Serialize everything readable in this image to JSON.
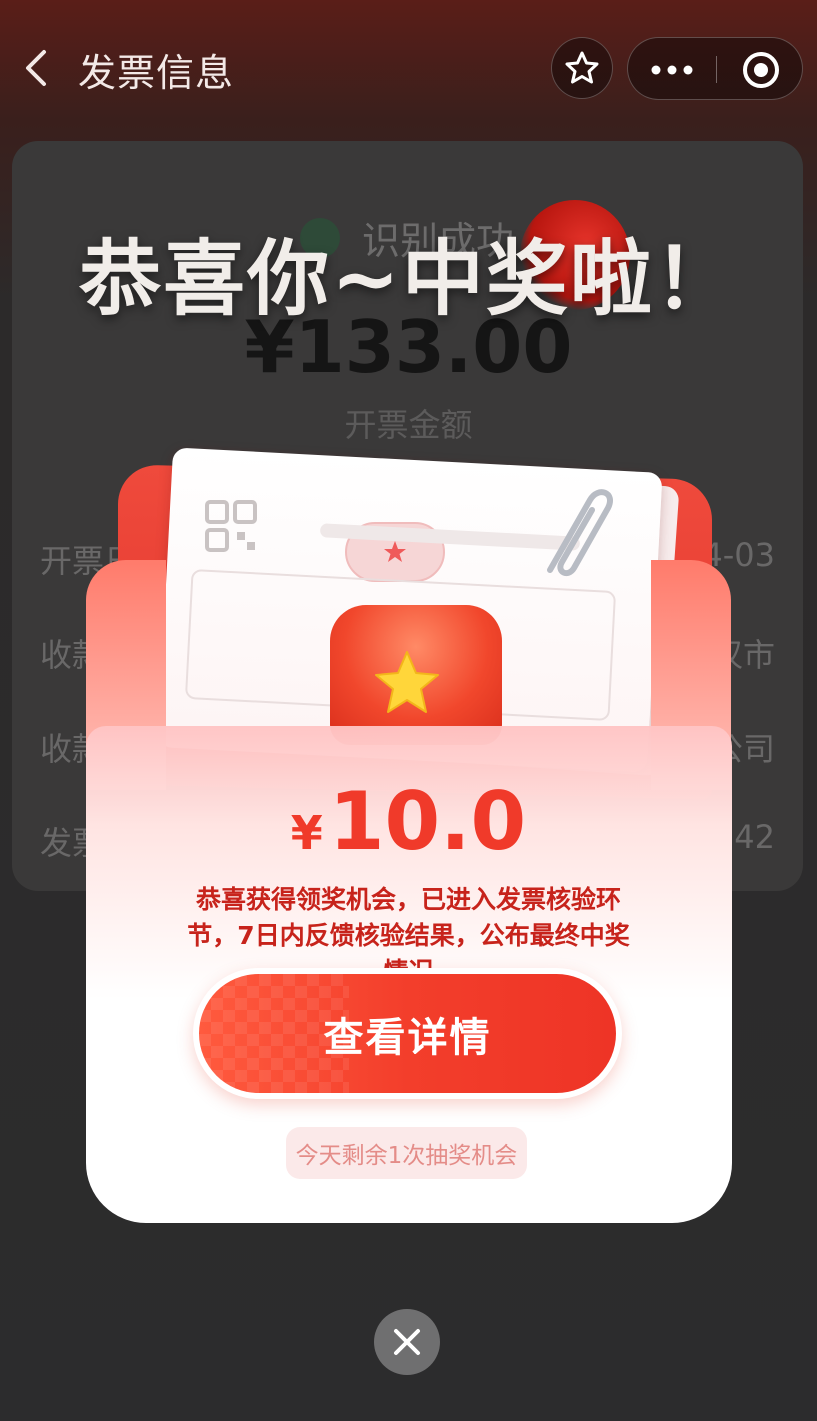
{
  "nav": {
    "title": "发票信息"
  },
  "background": {
    "status_text": "识别成功",
    "amount": "¥133.00",
    "amount_label": "开票金额",
    "rows": [
      {
        "label": "开票日",
        "value": "4-03"
      },
      {
        "label": "收款",
        "value": "汉市"
      },
      {
        "label": "收款",
        "value": "公司"
      },
      {
        "label": "发票",
        "value": "42"
      }
    ]
  },
  "modal": {
    "title": "恭喜你~中奖啦！",
    "prize_currency": "¥",
    "prize_value": "10.0",
    "description": "恭喜获得领奖机会，已进入发票核验环节，7日内反馈核验结果，公布最终中奖情况",
    "detail_button_label": "查看详情",
    "remaining_text": "今天剩余1次抽奖机会"
  },
  "colors": {
    "accent_red": "#f03a2a",
    "desc_red": "#c7231b"
  }
}
